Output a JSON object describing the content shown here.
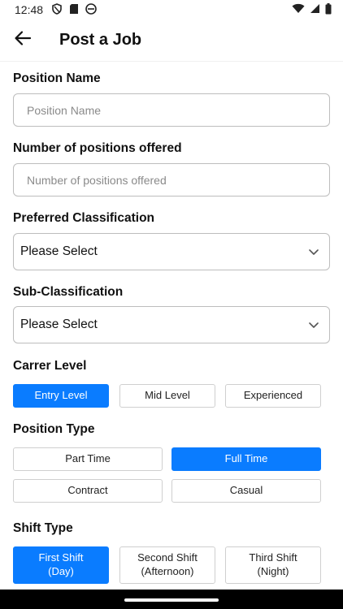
{
  "status": {
    "time": "12:48"
  },
  "header": {
    "title": "Post a Job"
  },
  "form": {
    "position_name": {
      "label": "Position Name",
      "placeholder": "Position Name"
    },
    "positions_offered": {
      "label": "Number of positions offered",
      "placeholder": "Number of positions offered"
    },
    "preferred_classification": {
      "label": "Preferred Classification",
      "value": "Please Select"
    },
    "sub_classification": {
      "label": "Sub-Classification",
      "value": "Please Select"
    },
    "career_level": {
      "label": "Carrer Level",
      "options": [
        "Entry Level",
        "Mid Level",
        "Experienced"
      ],
      "selected": "Entry Level"
    },
    "position_type": {
      "label": "Position Type",
      "options": [
        "Part Time",
        "Full Time",
        "Contract",
        "Casual"
      ],
      "selected": "Full Time"
    },
    "shift_type": {
      "label": "Shift Type",
      "options": [
        {
          "line1": "First Shift",
          "line2": "(Day)"
        },
        {
          "line1": "Second Shift",
          "line2": "(Afternoon)"
        },
        {
          "line1": "Third Shift",
          "line2": "(Night)"
        }
      ],
      "selected": "First Shift"
    }
  },
  "colors": {
    "accent": "#0a7cff",
    "border": "#bdbdbd",
    "placeholder": "#8a8a8a"
  }
}
